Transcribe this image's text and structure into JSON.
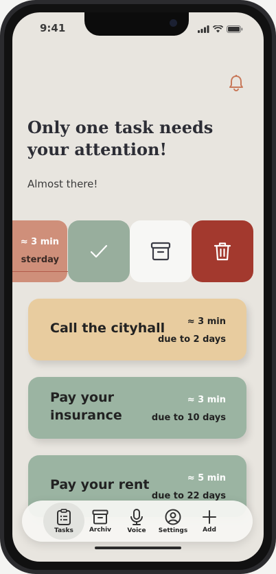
{
  "status": {
    "time": "9:41"
  },
  "header": {
    "title": "Only one task needs your attention!",
    "subtitle": "Almost there!"
  },
  "swiped_task": {
    "estimate": "≈ 3 min",
    "due": "sterday"
  },
  "tasks": [
    {
      "name": "Call the cityhall",
      "estimate": "≈ 3 min",
      "due": "due to 2 days",
      "color": "#e8cc9f"
    },
    {
      "name": "Pay your insurance",
      "name_line1": "Pay your",
      "name_line2": "insurance",
      "estimate": "≈ 3 min",
      "due": "due to 10 days",
      "color": "#9bb4a2"
    },
    {
      "name": "Pay your rent",
      "estimate": "≈ 5 min",
      "due": "due to 22 days",
      "color": "#9bb4a2"
    }
  ],
  "actions": {
    "done_color": "#98ae9d",
    "archive_color": "#f7f7f5",
    "delete_color": "#a3392e"
  },
  "nav": [
    {
      "label": "Tasks",
      "icon": "clipboard-icon",
      "active": true
    },
    {
      "label": "Archiv",
      "icon": "archive-box-icon"
    },
    {
      "label": "Voice",
      "icon": "microphone-icon"
    },
    {
      "label": "Settings",
      "icon": "user-circle-icon"
    },
    {
      "label": "Add",
      "icon": "plus-icon"
    }
  ],
  "colors": {
    "accent": "#c8795a",
    "background": "#e8e5df"
  }
}
